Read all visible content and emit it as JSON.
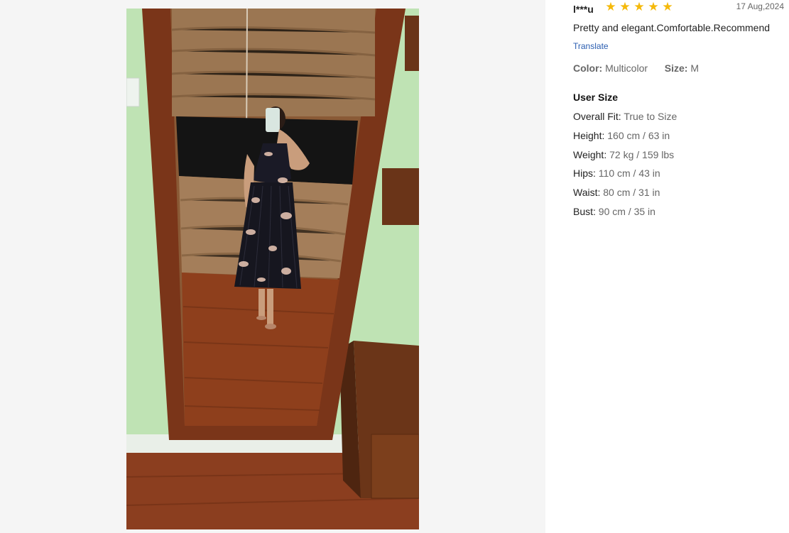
{
  "review": {
    "reviewer": "l***u",
    "rating": 5,
    "rating_max": 5,
    "date": "17 Aug,2024",
    "text": "Pretty and elegant.Comfortable.Recommend",
    "translate_label": "Translate",
    "attributes": {
      "color_label": "Color:",
      "color_value": "Multicolor",
      "size_label": "Size:",
      "size_value": "M"
    }
  },
  "user_size": {
    "title": "User Size",
    "items": [
      {
        "label": "Overall Fit:",
        "value": "True to Size"
      },
      {
        "label": "Height:",
        "value": "160 cm / 63 in"
      },
      {
        "label": "Weight:",
        "value": "72 kg / 159 lbs"
      },
      {
        "label": "Hips:",
        "value": "110 cm / 43 in"
      },
      {
        "label": "Waist:",
        "value": "80 cm / 31 in"
      },
      {
        "label": "Bust:",
        "value": "90 cm / 35 in"
      }
    ]
  },
  "colors": {
    "star": "#f5b90a",
    "link": "#2a5db0",
    "wall": "#bde2b3",
    "mirror_frame": "#7a3519",
    "floor": "#8a4020"
  }
}
